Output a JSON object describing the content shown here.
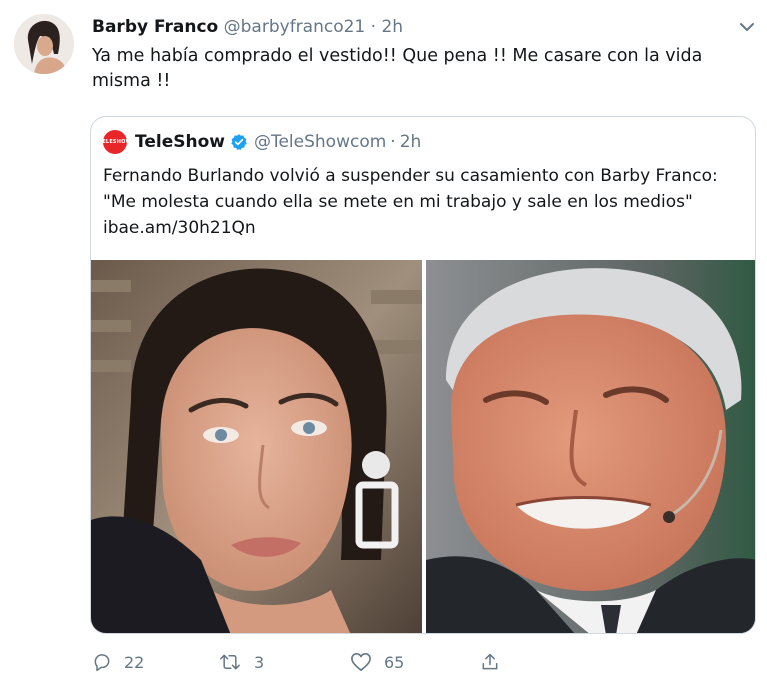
{
  "tweet": {
    "author_name": "Barby Franco",
    "handle": "@barbyfranco21",
    "separator": "·",
    "time": "2h",
    "text": "Ya me había comprado el  vestido!! Que pena !!  Me casare con la vida misma !!"
  },
  "quoted": {
    "logo_text": "TELESHOW",
    "author_name": "TeleShow",
    "handle": "@TeleShowcom",
    "separator": "·",
    "time": "2h",
    "text_line1": "Fernando Burlando volvió a suspender su casamiento con Barby Franco:",
    "text_line2": "\"Me molesta cuando ella se mete en mi trabajo y sale en los medios\"",
    "link": "ibae.am/30h21Qn"
  },
  "actions": {
    "replies": "22",
    "retweets": "3",
    "likes": "65"
  },
  "icons": [
    "chevron-down-icon",
    "verified-icon",
    "reply-icon",
    "retweet-icon",
    "like-icon",
    "share-icon"
  ],
  "colors": {
    "text": "#14171a",
    "muted": "#657786",
    "verified": "#1da1f2",
    "teleshow_red": "#e8262a",
    "border": "#cfd9de"
  }
}
